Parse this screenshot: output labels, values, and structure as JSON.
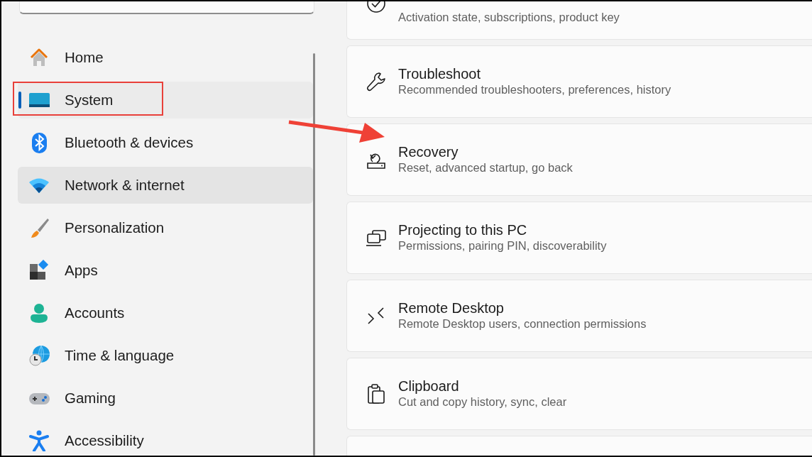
{
  "sidebar": {
    "items": [
      {
        "label": "Home",
        "selected": false,
        "hovered": false,
        "highlighted": false
      },
      {
        "label": "System",
        "selected": true,
        "hovered": false,
        "highlighted": true
      },
      {
        "label": "Bluetooth & devices",
        "selected": false,
        "hovered": false,
        "highlighted": false
      },
      {
        "label": "Network & internet",
        "selected": false,
        "hovered": true,
        "highlighted": false
      },
      {
        "label": "Personalization",
        "selected": false,
        "hovered": false,
        "highlighted": false
      },
      {
        "label": "Apps",
        "selected": false,
        "hovered": false,
        "highlighted": false
      },
      {
        "label": "Accounts",
        "selected": false,
        "hovered": false,
        "highlighted": false
      },
      {
        "label": "Time & language",
        "selected": false,
        "hovered": false,
        "highlighted": false
      },
      {
        "label": "Gaming",
        "selected": false,
        "hovered": false,
        "highlighted": false
      },
      {
        "label": "Accessibility",
        "selected": false,
        "hovered": false,
        "highlighted": false
      }
    ]
  },
  "cards": [
    {
      "description": "Activation state, subscriptions, product key",
      "pointed_at": false
    },
    {
      "title": "Troubleshoot",
      "description": "Recommended troubleshooters, preferences, history",
      "pointed_at": false
    },
    {
      "title": "Recovery",
      "description": "Reset, advanced startup, go back",
      "pointed_at": true
    },
    {
      "title": "Projecting to this PC",
      "description": "Permissions, pairing PIN, discoverability",
      "pointed_at": false
    },
    {
      "title": "Remote Desktop",
      "description": "Remote Desktop users, connection permissions",
      "pointed_at": false
    },
    {
      "title": "Clipboard",
      "description": "Cut and copy history, sync, clear",
      "pointed_at": false
    },
    {
      "pointed_at": false
    }
  ]
}
